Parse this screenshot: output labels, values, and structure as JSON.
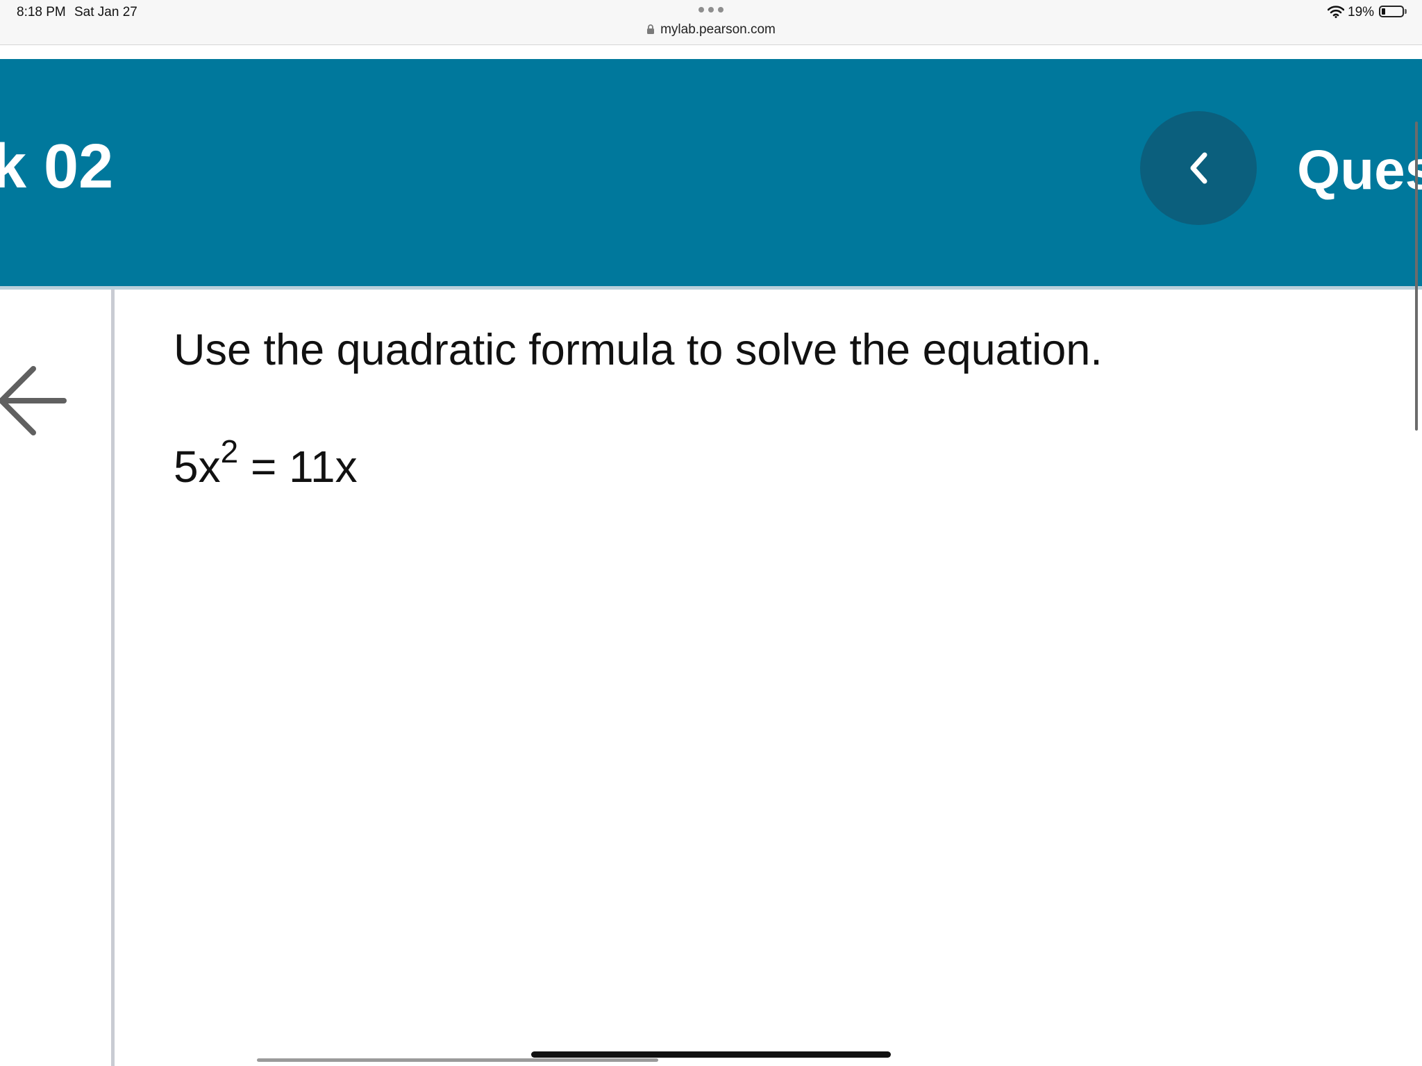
{
  "status_bar": {
    "time": "8:18 PM",
    "date": "Sat Jan 27",
    "url": "mylab.pearson.com",
    "battery_percent": "19%",
    "battery_level": 0.19,
    "wifi_icon": "wifi-icon",
    "lock_icon": "lock-icon"
  },
  "header": {
    "title": "k 02",
    "right_text": "Ques",
    "background_color": "#00789c",
    "prev_button_icon": "chevron-left-icon"
  },
  "left_rail": {
    "back_icon": "arrow-left-icon"
  },
  "question": {
    "prompt": "Use the quadratic formula to solve the equation.",
    "equation": {
      "lhs_coefficient": "5x",
      "exponent": "2",
      "rhs": " = 11x"
    }
  }
}
